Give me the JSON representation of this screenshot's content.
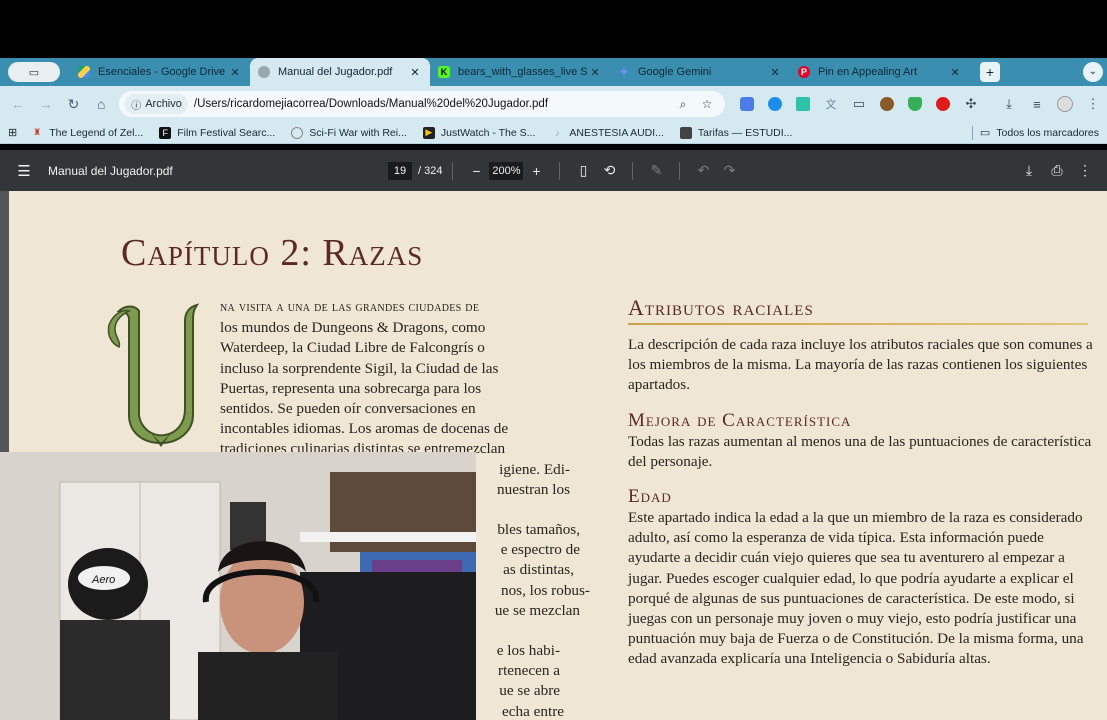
{
  "tabs": [
    {
      "title": "Esenciales - Google Drive",
      "favicon": "google-drive-icon",
      "color": "#1fa463"
    },
    {
      "title": "Manual del Jugador.pdf",
      "favicon": "globe-icon",
      "color": "#6b7c85",
      "active": true
    },
    {
      "title": "bears_with_glasses_live Stre",
      "favicon": "kick-icon",
      "color": "#53fc18"
    },
    {
      "title": "Google Gemini",
      "favicon": "gemini-icon",
      "color": "#6f8ff5"
    },
    {
      "title": "Pin en Appealing Art",
      "favicon": "pinterest-icon",
      "color": "#e60023"
    }
  ],
  "toolbar": {
    "chip_label": "Archivo",
    "url": "/Users/ricardomejiacorrea/Downloads/Manual%20del%20Jugador.pdf"
  },
  "bookmarks": {
    "items": [
      {
        "label": "The Legend of Zel...",
        "icon": "zelda-icon"
      },
      {
        "label": "Film Festival Searc...",
        "icon": "film-icon"
      },
      {
        "label": "Sci-Fi War with Rei...",
        "icon": "globe-icon"
      },
      {
        "label": "JustWatch - The S...",
        "icon": "justwatch-icon"
      },
      {
        "label": "ANESTESIA AUDI...",
        "icon": "music-icon"
      },
      {
        "label": "Tarifas — ESTUDI...",
        "icon": "cube-icon"
      }
    ],
    "all_label": "Todos los marcadores"
  },
  "pdf": {
    "title": "Manual del Jugador.pdf",
    "page": "19",
    "total": "/ 324",
    "zoom": "200%"
  },
  "page": {
    "chapter_title": "Capítulo 2: Razas",
    "left_lead": "na visita a una de las grandes ciudades de",
    "left_lines": [
      "los mundos de Dungeons & Dragons, como",
      "Waterdeep, la Ciudad Libre de Falcongrís o",
      "incluso la sorprendente Sigil, la Ciudad de las",
      "Puertas, representa una sobrecarga para los",
      "sentidos. Se pueden oír conversaciones en",
      "incontables idiomas. Los aromas de docenas de",
      "tradiciones culinarias distintas se entremezclan",
      "igiene. Edi-",
      "nuestran los",
      "",
      "bles tamaños,",
      "e espectro de",
      "as distintas,",
      "nos, los robus-",
      "ue se mezclan",
      "",
      "e los habi-",
      "rtenecen a",
      "ue se abre",
      "echa entre"
    ],
    "h_atributos": "Atributos raciales",
    "p_atributos": "La descripción de cada raza incluye los atributos raciales que son comunes a los miembros de la misma. La mayoría de las razas contienen los siguientes apartados.",
    "h_mejora": "Mejora de Característica",
    "p_mejora": "Todas las razas aumentan al menos una de las puntuaciones de característica del personaje.",
    "h_edad": "Edad",
    "p_edad": "Este apartado indica la edad a la que un miembro de la raza es considerado adulto, así como la esperanza de vida típica. Esta información puede ayudarte a decidir cuán viejo quieres que sea tu aventurero al empezar a jugar. Puedes escoger cualquier edad, lo que podría ayudarte a explicar el porqué de algunas de sus puntuaciones de característica. De este modo, si juegas con un personaje muy joven o muy viejo, esto podría justificar una puntuación muy baja de Fuerza o de Constitución. De la misma forma, una edad avanzada explicaría una Inteligencia o Sabiduría altas."
  },
  "webcam": {
    "cap_text": "Aero"
  },
  "colors": {
    "tabstrip": "#3a8fb0",
    "toolbar": "#d5e9f1",
    "pdfbar": "#323639",
    "parchment": "#efe6d4",
    "heading": "#5a2a23"
  }
}
